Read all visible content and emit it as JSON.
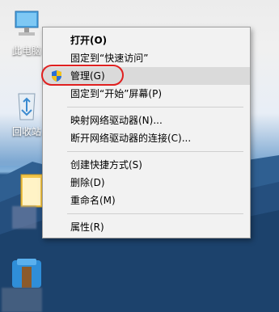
{
  "desktop": {
    "icons": [
      {
        "label": "此电脑",
        "icon": "computer-icon"
      },
      {
        "label": "回收站",
        "icon": "recycle-bin-icon"
      },
      {
        "label": "",
        "icon": "folder-icon"
      },
      {
        "label": "",
        "icon": "archive-icon"
      }
    ]
  },
  "context_menu": {
    "items": [
      {
        "label": "打开(O)",
        "bold": true
      },
      {
        "label": "固定到“快速访问”"
      },
      {
        "label": "管理(G)",
        "icon": "shield-icon",
        "highlighted": true
      },
      {
        "label": "固定到“开始”屏幕(P)"
      },
      {
        "label": "映射网络驱动器(N)..."
      },
      {
        "label": "断开网络驱动器的连接(C)..."
      },
      {
        "label": "创建快捷方式(S)"
      },
      {
        "label": "删除(D)"
      },
      {
        "label": "重命名(M)"
      },
      {
        "label": "属性(R)"
      }
    ]
  },
  "colors": {
    "menu_bg": "#f2f2f2",
    "hover_bg": "#dadada",
    "highlight_ring": "#e02020"
  }
}
